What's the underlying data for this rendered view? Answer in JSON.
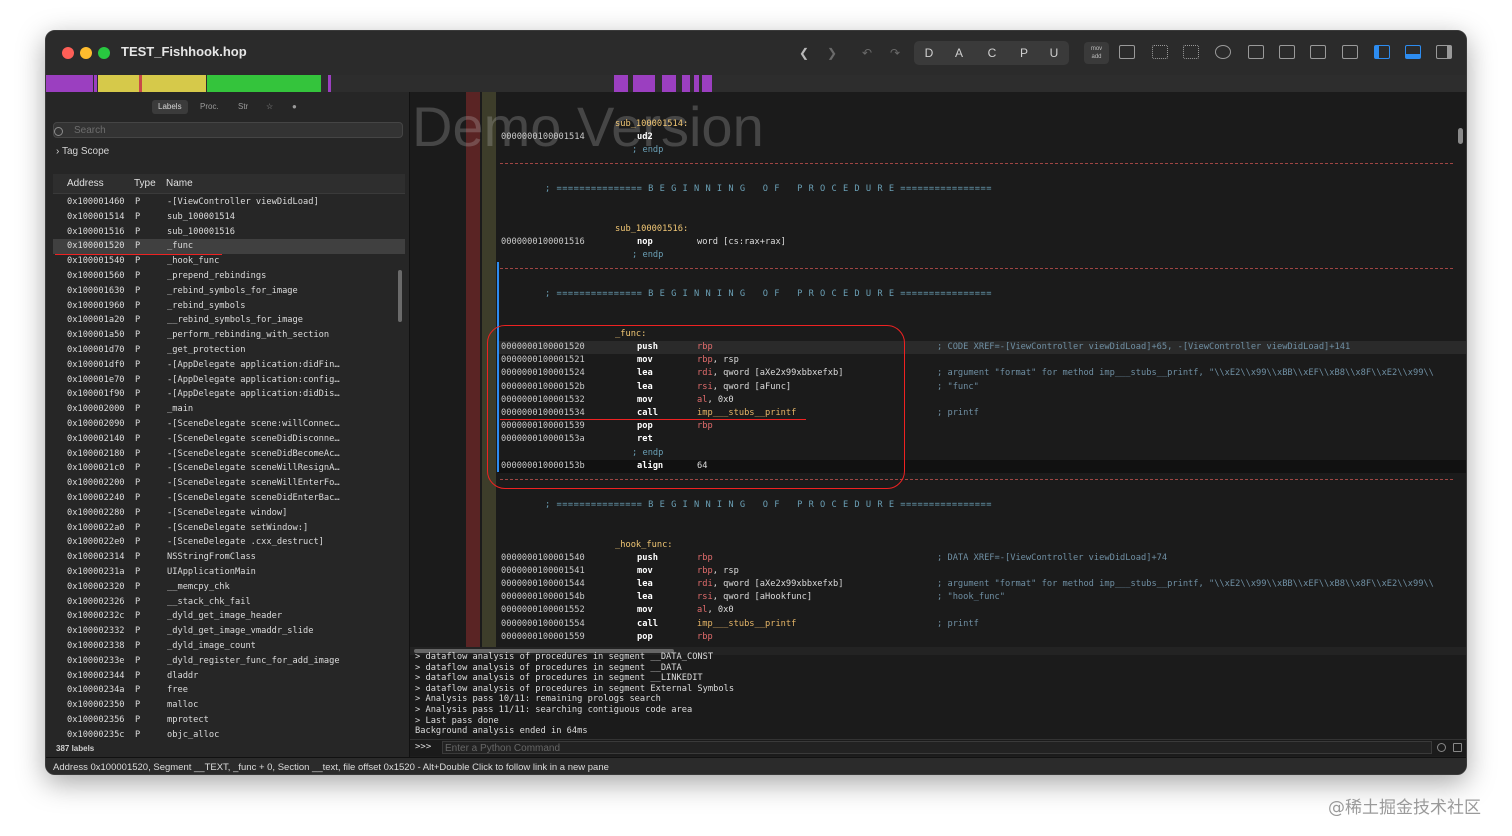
{
  "window": {
    "title": "TEST_Fishhook.hop"
  },
  "toolbar": {
    "letters": [
      "D",
      "A",
      "C",
      "P",
      "U"
    ],
    "mov_add": "mov\nadd"
  },
  "sidebar": {
    "tabs": [
      "Labels",
      "Proc.",
      "Str",
      "☆",
      "●"
    ],
    "search_placeholder": "Search",
    "tag_scope": "Tag Scope",
    "columns": {
      "address": "Address",
      "type": "Type",
      "name": "Name"
    },
    "rows": [
      [
        "0x100001460",
        "P",
        "-[ViewController viewDidLoad]"
      ],
      [
        "0x100001514",
        "P",
        "sub_100001514"
      ],
      [
        "0x100001516",
        "P",
        "sub_100001516"
      ],
      [
        "0x100001520",
        "P",
        "_func"
      ],
      [
        "0x100001540",
        "P",
        "_hook_func"
      ],
      [
        "0x100001560",
        "P",
        "_prepend_rebindings"
      ],
      [
        "0x100001630",
        "P",
        "_rebind_symbols_for_image"
      ],
      [
        "0x100001960",
        "P",
        "_rebind_symbols"
      ],
      [
        "0x100001a20",
        "P",
        "__rebind_symbols_for_image"
      ],
      [
        "0x100001a50",
        "P",
        "_perform_rebinding_with_section"
      ],
      [
        "0x100001d70",
        "P",
        "_get_protection"
      ],
      [
        "0x100001df0",
        "P",
        "-[AppDelegate application:didFinish…"
      ],
      [
        "0x100001e70",
        "P",
        "-[AppDelegate application:configurat…"
      ],
      [
        "0x100001f90",
        "P",
        "-[AppDelegate application:didDiscard…"
      ],
      [
        "0x100002000",
        "P",
        "_main"
      ],
      [
        "0x100002090",
        "P",
        "-[SceneDelegate scene:willConnectToS…"
      ],
      [
        "0x100002140",
        "P",
        "-[SceneDelegate sceneDidDisconnect:]"
      ],
      [
        "0x100002180",
        "P",
        "-[SceneDelegate sceneDidBecomeActive…"
      ],
      [
        "0x1000021c0",
        "P",
        "-[SceneDelegate sceneWillResignActiv…"
      ],
      [
        "0x100002200",
        "P",
        "-[SceneDelegate sceneWillEnterForegr…"
      ],
      [
        "0x100002240",
        "P",
        "-[SceneDelegate sceneDidEnterBackgro…"
      ],
      [
        "0x100002280",
        "P",
        "-[SceneDelegate window]"
      ],
      [
        "0x1000022a0",
        "P",
        "-[SceneDelegate setWindow:]"
      ],
      [
        "0x1000022e0",
        "P",
        "-[SceneDelegate .cxx_destruct]"
      ],
      [
        "0x100002314",
        "P",
        "NSStringFromClass"
      ],
      [
        "0x10000231a",
        "P",
        "UIApplicationMain"
      ],
      [
        "0x100002320",
        "P",
        "__memcpy_chk"
      ],
      [
        "0x100002326",
        "P",
        "__stack_chk_fail"
      ],
      [
        "0x10000232c",
        "P",
        "_dyld_get_image_header"
      ],
      [
        "0x100002332",
        "P",
        "_dyld_get_image_vmaddr_slide"
      ],
      [
        "0x100002338",
        "P",
        "_dyld_image_count"
      ],
      [
        "0x10000233e",
        "P",
        "_dyld_register_func_for_add_image"
      ],
      [
        "0x100002344",
        "P",
        "dladdr"
      ],
      [
        "0x10000234a",
        "P",
        "free"
      ],
      [
        "0x100002350",
        "P",
        "malloc"
      ],
      [
        "0x100002356",
        "P",
        "mprotect"
      ],
      [
        "0x10000235c",
        "P",
        "objc_alloc"
      ]
    ],
    "labels_count": "387 labels"
  },
  "code": {
    "watermark": "Demo Version",
    "banner": "; =============== B E G I N N I N G   O F   P R O C E D U R E ================",
    "l_sub1514": "sub_100001514:",
    "a_1514": "0000000100001514",
    "m_ud2": "ud2",
    "endp": "; endp",
    "l_sub1516": "sub_100001516:",
    "a_1516": "0000000100001516",
    "m_nop": "nop",
    "o_nop": "word [cs:rax+rax]",
    "l_func": "_func:",
    "func": [
      {
        "a": "0000000100001520",
        "m": "push",
        "o": "rbp",
        "c": "; CODE XREF=-[ViewController viewDidLoad]+65, -[ViewController viewDidLoad]+141"
      },
      {
        "a": "0000000100001521",
        "m": "mov",
        "o": "rbp, rsp",
        "c": ""
      },
      {
        "a": "0000000100001524",
        "m": "lea",
        "o": "rdi, qword [aXe2x99xbbxefxb]",
        "c": "; argument \"format\" for method imp___stubs__printf, \"\\\\xE2\\\\x99\\\\xBB\\\\xEF\\\\xB8\\\\x8F\\\\xE2\\\\x99\\\\"
      },
      {
        "a": "000000010000152b",
        "m": "lea",
        "o": "rsi, qword [aFunc]",
        "c": "; \"func\""
      },
      {
        "a": "0000000100001532",
        "m": "mov",
        "o": "al, 0x0",
        "c": ""
      },
      {
        "a": "0000000100001534",
        "m": "call",
        "o": "imp___stubs__printf",
        "c": "; printf"
      },
      {
        "a": "0000000100001539",
        "m": "pop",
        "o": "rbp",
        "c": ""
      },
      {
        "a": "000000010000153a",
        "m": "ret",
        "o": "",
        "c": ""
      }
    ],
    "a_153b": "000000010000153b",
    "m_align": "align",
    "o_align": "64",
    "l_hook": "_hook_func:",
    "hook": [
      {
        "a": "0000000100001540",
        "m": "push",
        "o": "rbp",
        "c": "; DATA XREF=-[ViewController viewDidLoad]+74"
      },
      {
        "a": "0000000100001541",
        "m": "mov",
        "o": "rbp, rsp",
        "c": ""
      },
      {
        "a": "0000000100001544",
        "m": "lea",
        "o": "rdi, qword [aXe2x99xbbxefxb]",
        "c": "; argument \"format\" for method imp___stubs__printf, \"\\\\xE2\\\\x99\\\\xBB\\\\xEF\\\\xB8\\\\x8F\\\\xE2\\\\x99\\\\"
      },
      {
        "a": "000000010000154b",
        "m": "lea",
        "o": "rsi, qword [aHookfunc]",
        "c": "; \"hook_func\""
      },
      {
        "a": "0000000100001552",
        "m": "mov",
        "o": "al, 0x0",
        "c": ""
      },
      {
        "a": "0000000100001554",
        "m": "call",
        "o": "imp___stubs__printf",
        "c": "; printf"
      },
      {
        "a": "0000000100001559",
        "m": "pop",
        "o": "rbp",
        "c": ""
      }
    ]
  },
  "console": {
    "lines": [
      "> dataflow analysis of procedures in segment __DATA_CONST",
      "> dataflow analysis of procedures in segment __DATA",
      "> dataflow analysis of procedures in segment __LINKEDIT",
      "> dataflow analysis of procedures in segment External Symbols",
      "> Analysis pass 10/11: remaining prologs search",
      "> Analysis pass 11/11: searching contiguous code area",
      "> Last pass done",
      "Background analysis ended in 64ms"
    ],
    "prompt": ">>>",
    "input_placeholder": "Enter a Python Command"
  },
  "status": "Address 0x100001520, Segment __TEXT, _func + 0, Section __text, file offset 0x1520 - Alt+Double Click to follow link in a new pane",
  "credit": "@稀土掘金技术社区",
  "colors": {
    "annotation": "#e22222",
    "accent": "#2d8cf0"
  }
}
